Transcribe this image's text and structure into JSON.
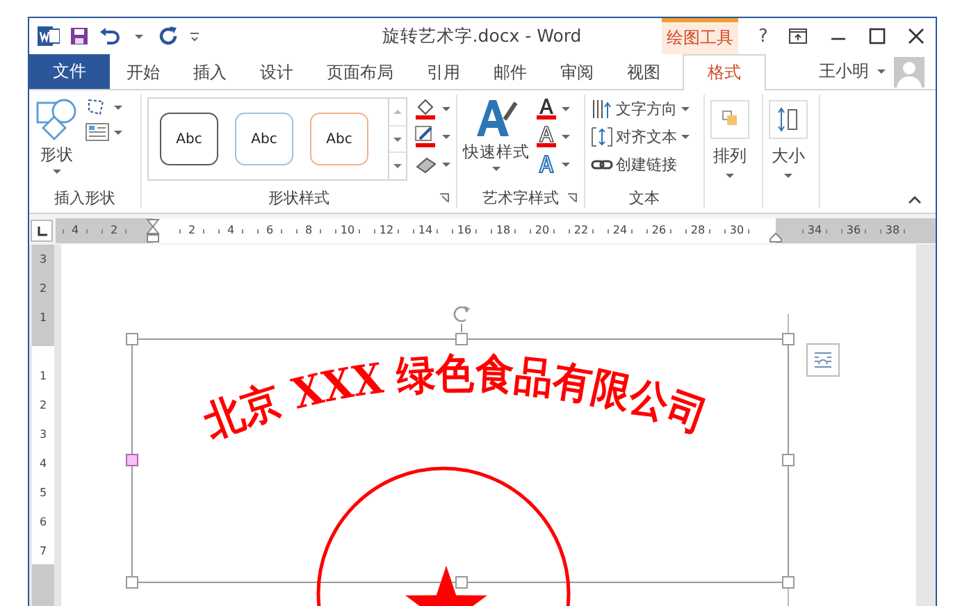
{
  "title_bar": {
    "title": "旋转艺术字.docx - Word",
    "context_tab": "绘图工具",
    "help": "?"
  },
  "file_tab": "文件",
  "tabs": [
    {
      "label": "开始",
      "selected": false
    },
    {
      "label": "插入",
      "selected": false
    },
    {
      "label": "设计",
      "selected": false
    },
    {
      "label": "页面布局",
      "selected": false
    },
    {
      "label": "引用",
      "selected": false
    },
    {
      "label": "邮件",
      "selected": false
    },
    {
      "label": "审阅",
      "selected": false
    },
    {
      "label": "视图",
      "selected": false
    },
    {
      "label": "格式",
      "selected": true
    }
  ],
  "user": {
    "name": "王小明"
  },
  "ribbon": {
    "insert_shapes": {
      "label": "插入形状",
      "button": "形状"
    },
    "shape_styles": {
      "label": "形状样式",
      "styles": [
        {
          "text": "Abc",
          "color": "#595959"
        },
        {
          "text": "Abc",
          "color": "#9dc3e6"
        },
        {
          "text": "Abc",
          "color": "#f4b183"
        }
      ]
    },
    "wordart_styles": {
      "label": "艺术字样式",
      "button": "快速样式"
    },
    "text": {
      "label": "文本",
      "items": [
        {
          "label": "文字方向",
          "dropdown": true
        },
        {
          "label": "对齐文本",
          "dropdown": true
        },
        {
          "label": "创建链接",
          "dropdown": false
        }
      ]
    },
    "arrange": {
      "label": "排列"
    },
    "size": {
      "label": "大小"
    }
  },
  "ruler": {
    "left_labels": [
      "4",
      "2"
    ],
    "body_labels": [
      "2",
      "4",
      "6",
      "8",
      "10",
      "12",
      "14",
      "16",
      "18",
      "20",
      "22",
      "24",
      "26",
      "28",
      "30"
    ],
    "right_labels": [
      "34",
      "36",
      "38"
    ],
    "vertical_top_labels": [
      "3",
      "2",
      "1"
    ],
    "vertical_body_labels": [
      "1",
      "2",
      "3",
      "4",
      "5",
      "6",
      "7"
    ]
  },
  "document": {
    "wordart": "北京 XXX 绿色食品有限公司"
  }
}
